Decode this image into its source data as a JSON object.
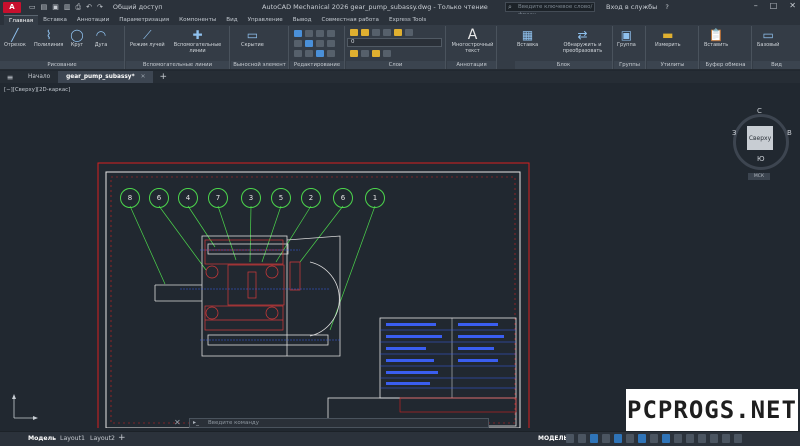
{
  "app": {
    "logo": "A",
    "doc_title": "AutoCAD Mechanical 2026   gear_pump_subassy.dwg - Только чтение",
    "share_label": "Общий доступ",
    "search_placeholder": "Введите ключевое слово/фразу",
    "sign_in": "Вход в службы",
    "help": "?"
  },
  "ribbon_tabs": [
    "Главная",
    "Вставка",
    "Аннотации",
    "Параметризация",
    "Компоненты",
    "Вид",
    "Управление",
    "Вывод",
    "Совместная работа",
    "Express Tools"
  ],
  "ribbon": {
    "draw_group": "Рисование",
    "draw_tools": [
      "Отрезок",
      "Полилиния",
      "Круг",
      "Дуга"
    ],
    "construction_group": "Вспомогательные линии",
    "construction_tools": [
      "Режим лучей",
      "Вспомогательные линии"
    ],
    "detail_group": "Выносной элемент",
    "detail_tool": "Скрытие",
    "modify_group": "Редактирование",
    "layers_group": "Слои",
    "layer_value": "0",
    "annotation_group": "Аннотация",
    "annotation_tool": "Многострочный текст",
    "block_group": "Блок",
    "block_tools": [
      "Вставка",
      "Обнаружить и преобразовать"
    ],
    "groups_group": "Группы",
    "groups_tool": "Группа",
    "utilities_group": "Утилиты",
    "utilities_tool": "Измерить",
    "clipboard_group": "Буфер обмена",
    "clipboard_tool": "Вставить",
    "view_group": "Вид",
    "view_tool": "Базовый"
  },
  "file_tabs": {
    "start": "Начало",
    "active": "gear_pump_subassy*"
  },
  "viewport_label": "[−][Сверху][2D-каркас]",
  "viewcube": {
    "top": "Сверху",
    "north": "С",
    "south": "Ю",
    "west": "З",
    "east": "В",
    "wcs": "МСК"
  },
  "balloons": [
    "8",
    "6",
    "4",
    "7",
    "3",
    "5",
    "2",
    "6",
    "1"
  ],
  "command_placeholder": "Введите команду",
  "layout_tabs": [
    "Модель",
    "Layout1",
    "Layout2"
  ],
  "status_model": "МОДЕЛЬ",
  "watermark": "PCPROGS.NET",
  "colors": {
    "frame_red": "#d62020",
    "frame_white": "#e6e6e6",
    "balloon_green": "#4cd64c",
    "part_white": "#dcdcdc",
    "section_red": "#d63a3a",
    "table_blue": "#3a5ef0"
  }
}
